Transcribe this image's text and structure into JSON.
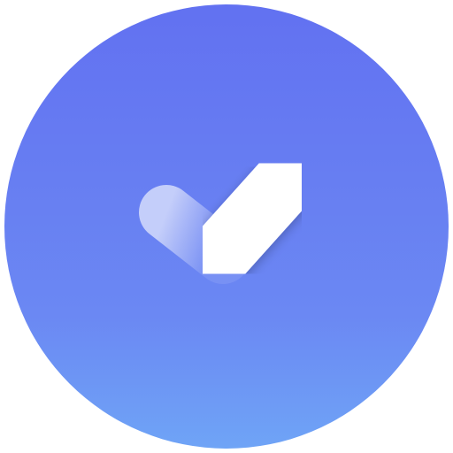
{
  "icon": {
    "name": "checkmark-icon",
    "shape": "circle",
    "gradient_top_color": "#6271F1",
    "gradient_bottom_color": "#6FA4F6",
    "check_color": "#FFFFFF",
    "check_short_stroke_color": "#C9D2FA"
  }
}
